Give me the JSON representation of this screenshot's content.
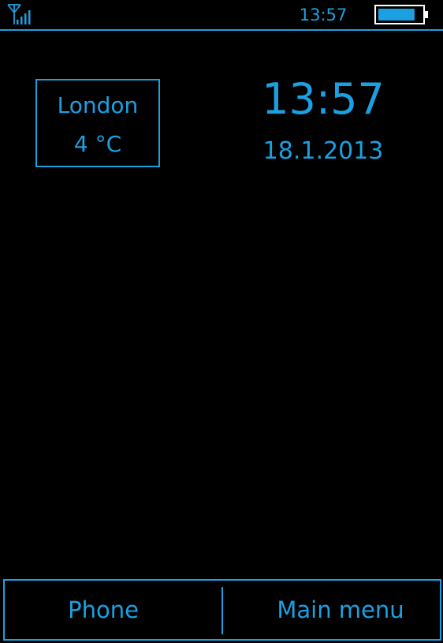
{
  "theme": {
    "accent": "#1ba1e2",
    "background": "#000000"
  },
  "status_bar": {
    "time": "13:57",
    "signal_icon": "signal-strength-icon",
    "battery_icon": "battery-icon",
    "battery_level_fraction": 0.85
  },
  "weather": {
    "city": "London",
    "temperature": "4 °C"
  },
  "clock": {
    "time": "13:57",
    "date": "18.1.2013"
  },
  "softkeys": {
    "left_label": "Phone",
    "right_label": "Main menu"
  }
}
